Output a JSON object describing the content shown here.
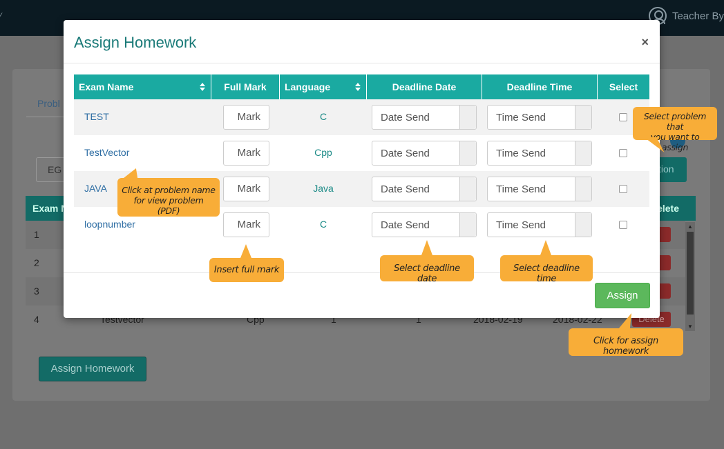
{
  "topbar": {
    "user_label": "Teacher By",
    "user_icon": "user-circle-icon"
  },
  "background": {
    "tab_label": "Probl",
    "select_value": "EG",
    "table": {
      "header_left": "Exam N",
      "header_right": "elete",
      "rows": [
        {
          "num": "1",
          "name": "",
          "lang": "",
          "c3": "",
          "c4": "",
          "d1": "",
          "d2": "",
          "delete": "te"
        },
        {
          "num": "2",
          "name": "",
          "lang": "",
          "c3": "",
          "c4": "",
          "d1": "",
          "d2": "",
          "delete": "te"
        },
        {
          "num": "3",
          "name": "",
          "lang": "",
          "c3": "",
          "c4": "",
          "d1": "",
          "d2": "",
          "delete": "te"
        },
        {
          "num": "4",
          "name": "Testvector",
          "lang": "Cpp",
          "c3": "1",
          "c4": "1",
          "d1": "2018-02-19",
          "d2": "2018-02-22",
          "delete": "Delete"
        }
      ]
    },
    "right_button": "tion",
    "assign_button": "Assign Homework"
  },
  "modal": {
    "title": "Assign Homework",
    "close": "×",
    "columns": [
      "Exam Name",
      "Full Mark",
      "Language",
      "Deadline Date",
      "Deadline Time",
      "Select"
    ],
    "rows": [
      {
        "name": "TEST",
        "mark_placeholder": "Mark",
        "language": "C",
        "date_placeholder": "Date Send",
        "time_placeholder": "Time Send"
      },
      {
        "name": "TestVector",
        "mark_placeholder": "Mark",
        "language": "Cpp",
        "date_placeholder": "Date Send",
        "time_placeholder": "Time Send"
      },
      {
        "name": "JAVA",
        "mark_placeholder": "Mark",
        "language": "Java",
        "date_placeholder": "Date Send",
        "time_placeholder": "Time Send"
      },
      {
        "name": "loopnumber",
        "mark_placeholder": "Mark",
        "language": "C",
        "date_placeholder": "Date Send",
        "time_placeholder": "Time Send"
      }
    ],
    "assign_button": "Assign"
  },
  "callouts": {
    "name": [
      "Click at problem name",
      "for view problem (PDF)"
    ],
    "mark": "Insert full mark",
    "date": "Select deadline date",
    "time": "Select deadline time",
    "select": [
      "Select problem that",
      "you want to assign"
    ],
    "assign": "Click for assign homework"
  },
  "colors": {
    "header_teal": "#1aaaa1",
    "title_teal": "#1a7a78",
    "link_blue": "#2d6da3",
    "assign_green": "#5cb85c",
    "callout_orange": "#f8ad38"
  }
}
